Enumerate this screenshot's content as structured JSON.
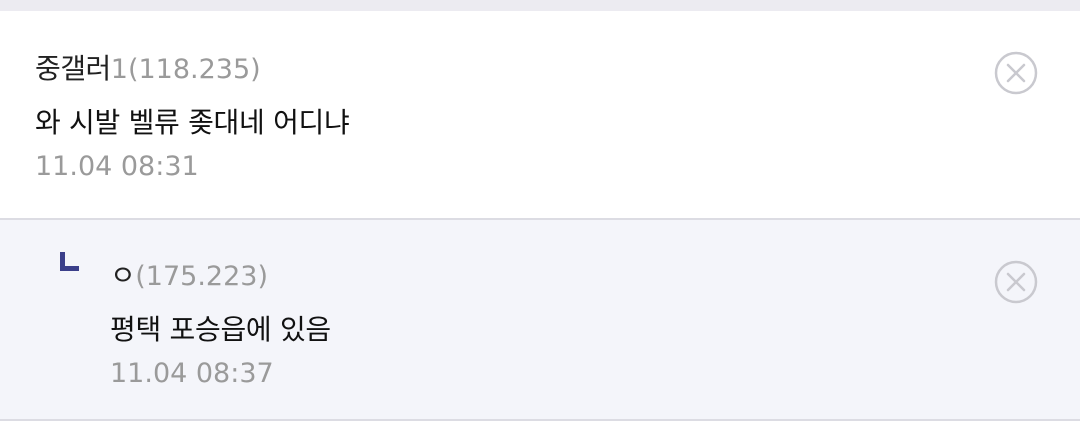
{
  "comments": [
    {
      "nickname": "중갤러",
      "nick_suffix": "1",
      "ip": "(118.235)",
      "text": "와 시발 벨류 좆대네 어디냐",
      "date": "11.04 08:31",
      "delete_icon": "circle-x-icon"
    }
  ],
  "replies": [
    {
      "reply_icon": "reply-arrow-icon",
      "nickname": "ㅇ",
      "ip": "(175.223)",
      "text": "평택 포승읍에 있음",
      "date": "11.04 08:37",
      "delete_icon": "circle-x-icon"
    }
  ],
  "colors": {
    "reply_icon": "#3b3f8a",
    "delete_icon": "#c9c9cf",
    "reply_background": "#f4f5fa",
    "meta_text": "#9a9a9a"
  }
}
